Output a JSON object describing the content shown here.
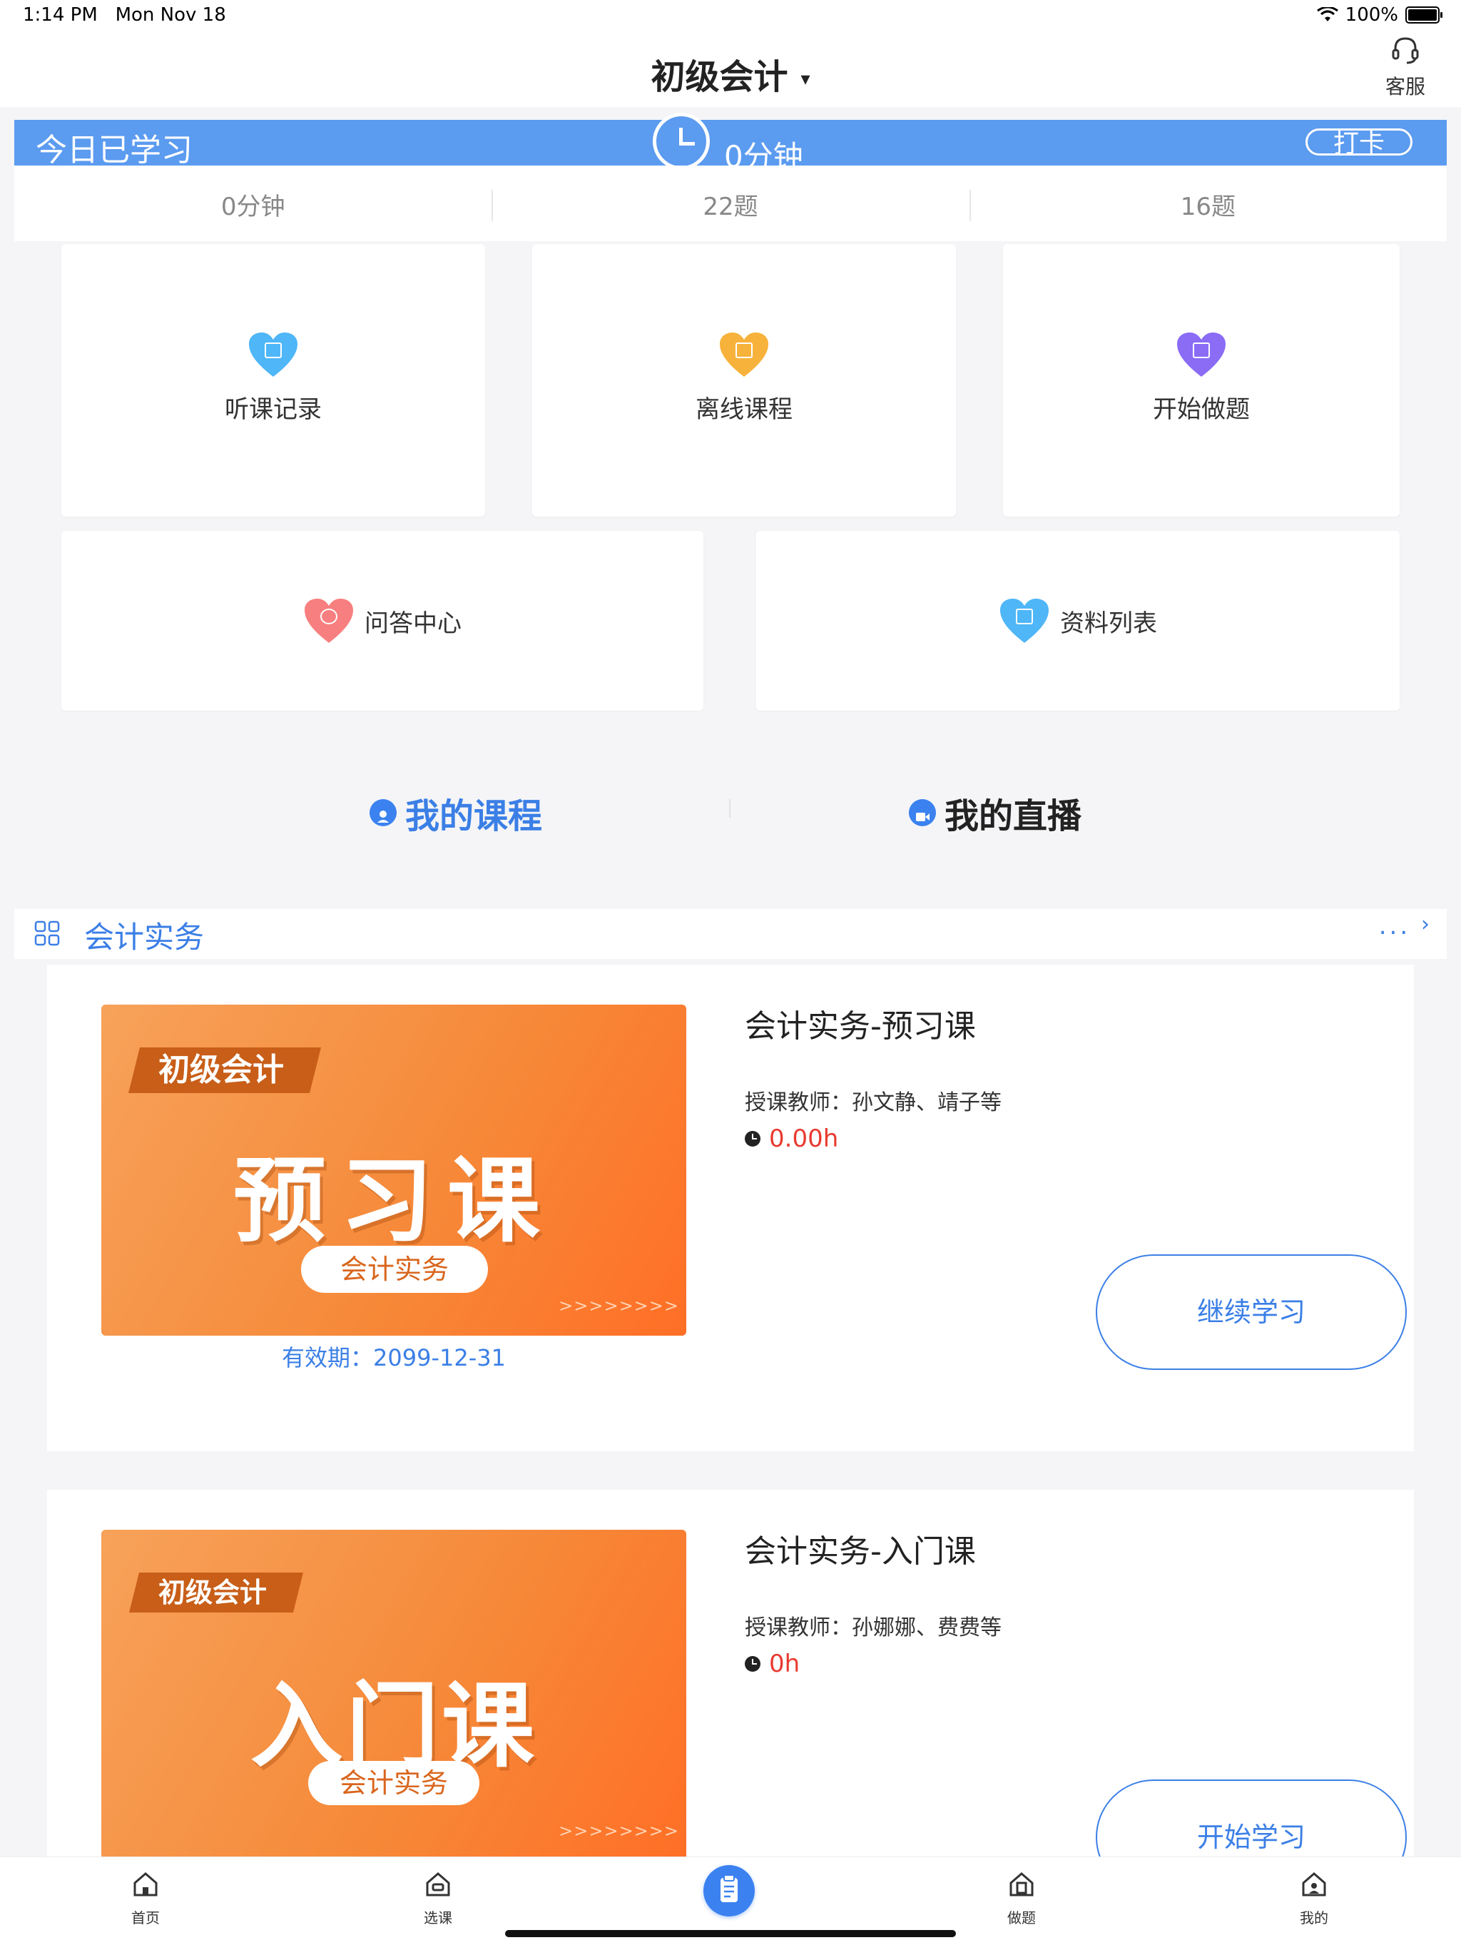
{
  "status_bar": {
    "time": "1:14 PM",
    "date": "Mon Nov 18",
    "battery": "100%"
  },
  "header": {
    "title": "初级会计",
    "service_label": "客服"
  },
  "today": {
    "label": "今日已学习",
    "minutes": "0分钟",
    "checkin": "打卡"
  },
  "stats": [
    "0分钟",
    "22题",
    "16题"
  ],
  "features_top": [
    {
      "label": "听课记录",
      "icon": "history-icon",
      "color": "#4fb6f7"
    },
    {
      "label": "离线课程",
      "icon": "offline-icon",
      "color": "#f7b23b"
    },
    {
      "label": "开始做题",
      "icon": "practice-icon",
      "color": "#8a6cf5"
    }
  ],
  "features_bottom": [
    {
      "label": "问答中心",
      "icon": "qa-icon",
      "color": "#f77f7f"
    },
    {
      "label": "资料列表",
      "icon": "materials-icon",
      "color": "#4fb6f7"
    }
  ],
  "tabs": {
    "courses": "我的课程",
    "live": "我的直播"
  },
  "section": {
    "title": "会计实务",
    "more": "...",
    "more_arrow": "›"
  },
  "courses": [
    {
      "thumb_tag": "初级会计",
      "thumb_big": "预习课",
      "thumb_pill": "会计实务",
      "thumb_arrows": ">>>>>>>>",
      "name": "会计实务-预习课",
      "teacher": "授课教师：孙文静、靖子等",
      "hours": "0.00h",
      "expiry": "有效期：2099-12-31",
      "action": "继续学习"
    },
    {
      "thumb_tag": "初级会计",
      "thumb_big": "入门课",
      "thumb_pill": "会计实务",
      "thumb_arrows": ">>>>>>>>",
      "name": "会计实务-入门课",
      "teacher": "授课教师：孙娜娜、费费等",
      "hours": "0h",
      "action": "开始学习"
    }
  ],
  "tabbar": {
    "home": "首页",
    "select": "选课",
    "practice": "做题",
    "mine": "我的"
  },
  "colors": {
    "accent": "#3b7fe6",
    "banner": "#5b9bf0",
    "hours": "#e83a2f",
    "thumb": "#f68a3a"
  }
}
